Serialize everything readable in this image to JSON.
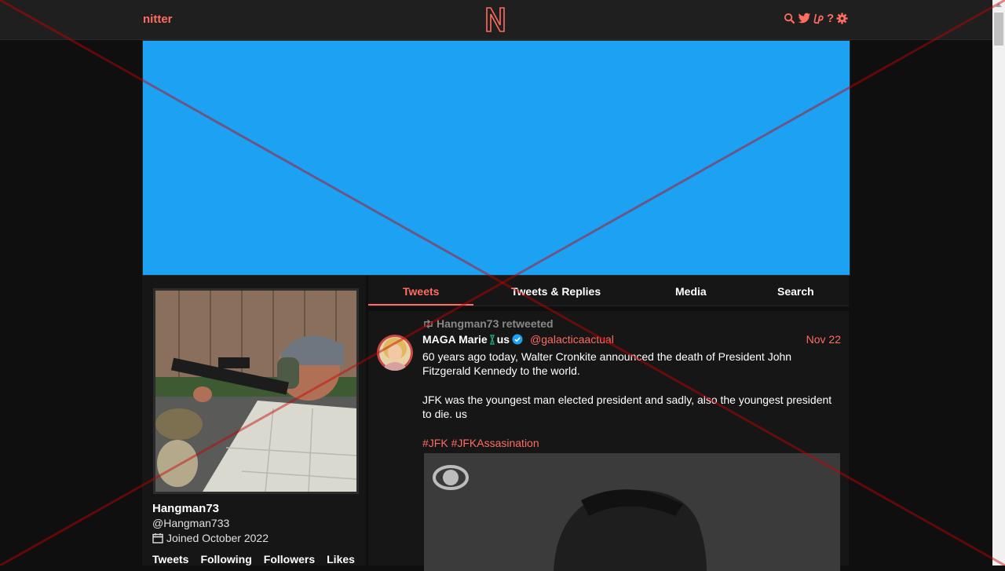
{
  "nav": {
    "brand": "nitter",
    "logo_letter": "N",
    "icons": [
      "search-icon",
      "twitter-bird-icon",
      "liberapay-icon",
      "help-icon",
      "gear-icon"
    ],
    "help_label": "?"
  },
  "colors": {
    "accent": "#ff6c60",
    "banner": "#1da1f2",
    "background": "#0f0f0f",
    "panel": "#161616",
    "verified": "#1da1f2"
  },
  "profile": {
    "fullname": "Hangman73",
    "username": "@Hangman733",
    "joined": "Joined October 2022",
    "stats": [
      "Tweets",
      "Following",
      "Followers",
      "Likes"
    ]
  },
  "tabs": [
    {
      "label": "Tweets",
      "active": true
    },
    {
      "label": "Tweets & Replies",
      "active": false
    },
    {
      "label": "Media",
      "active": false
    },
    {
      "label": "Search",
      "active": false
    }
  ],
  "tweet": {
    "retweet_label": "Hangman73 retweeted",
    "fullname": "MAGA Marie",
    "name_suffix": "us",
    "username": "@galacticaactual",
    "date": "Nov 22",
    "paragraphs": [
      "60 years ago today, Walter Cronkite announced the death of President John Fitzgerald Kennedy to the world.",
      "JFK was the youngest man elected president and sadly, also the youngest president to die. us"
    ],
    "hashtags": "#JFK #JFKAssasination"
  }
}
